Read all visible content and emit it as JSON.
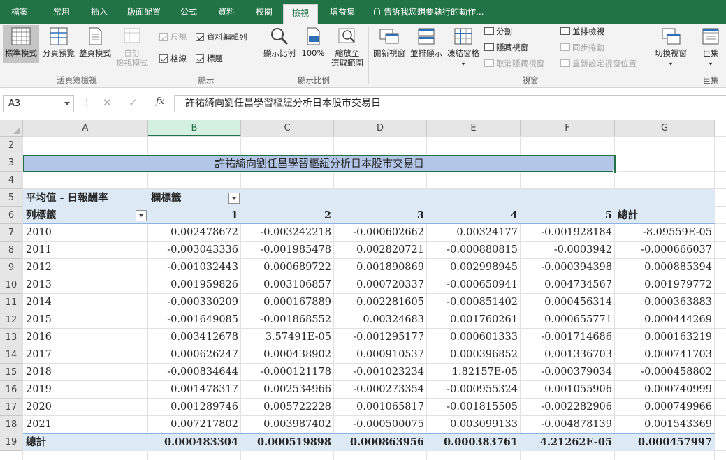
{
  "tabs": [
    {
      "label": "檔案",
      "active": false
    },
    {
      "label": "常用",
      "active": false
    },
    {
      "label": "插入",
      "active": false
    },
    {
      "label": "版面配置",
      "active": false
    },
    {
      "label": "公式",
      "active": false
    },
    {
      "label": "資料",
      "active": false
    },
    {
      "label": "校閱",
      "active": false
    },
    {
      "label": "檢視",
      "active": true
    },
    {
      "label": "增益集",
      "active": false
    }
  ],
  "tell_me": "告訴我您想要執行的動作...",
  "ribbon": {
    "workbook_views": {
      "normal": "標準模式",
      "page_break": "分頁預覽",
      "page_layout": "整頁模式",
      "custom_1": "自訂",
      "custom_2": "檢視模式",
      "label": "活頁簿檢視"
    },
    "show": {
      "ruler": "尺規",
      "formula_bar": "資料編輯列",
      "gridlines": "格線",
      "headings": "標題",
      "label": "顯示"
    },
    "zoom": {
      "zoom": "顯示比例",
      "hundred": "100%",
      "to_sel_1": "縮放至",
      "to_sel_2": "選取範圍",
      "label": "顯示比例"
    },
    "window": {
      "new_window": "開新視窗",
      "arrange_all": "並排顯示",
      "freeze": "凍結窗格",
      "split": "分割",
      "hide": "隱藏視窗",
      "unhide": "取消隱藏視窗",
      "side_by_side": "並排檢視",
      "sync_scroll": "同步捲動",
      "reset_pos": "重新設定視窗位置",
      "switch": "切換視窗",
      "label": "視窗"
    },
    "macros": {
      "macros": "巨集",
      "label": "巨集"
    }
  },
  "formula_bar": {
    "name_box": "A3",
    "cancel": "✕",
    "enter": "✓",
    "fx": "fx",
    "content": "許祐綺向劉任昌學習樞紐分析日本股市交易日"
  },
  "columns": [
    "A",
    "B",
    "C",
    "D",
    "E",
    "F",
    "G"
  ],
  "selected_column": "B",
  "rows": [
    "2",
    "3",
    "4",
    "5",
    "6",
    "7",
    "8",
    "9",
    "10",
    "11",
    "12",
    "13",
    "14",
    "15",
    "16",
    "17",
    "18",
    "19"
  ],
  "sheet": {
    "title": "許祐綺向劉任昌學習樞紐分析日本股市交易日",
    "pivot_value_label": "平均值 - 日報酬率",
    "col_labels": "欄標籤",
    "row_labels": "列標籤",
    "col_headers": [
      "1",
      "2",
      "3",
      "4",
      "5",
      "總計"
    ],
    "data": [
      {
        "year": "2010",
        "v": [
          "0.002478672",
          "-0.003242218",
          "-0.000602662",
          "0.00324177",
          "-0.001928184",
          "-8.09559E-05"
        ]
      },
      {
        "year": "2011",
        "v": [
          "-0.003043336",
          "-0.001985478",
          "0.002820721",
          "-0.000880815",
          "-0.0003942",
          "-0.000666037"
        ]
      },
      {
        "year": "2012",
        "v": [
          "-0.001032443",
          "0.000689722",
          "0.001890869",
          "0.002998945",
          "-0.000394398",
          "0.000885394"
        ]
      },
      {
        "year": "2013",
        "v": [
          "0.001959826",
          "0.003106857",
          "0.000720337",
          "-0.000650941",
          "0.004734567",
          "0.001979772"
        ]
      },
      {
        "year": "2014",
        "v": [
          "-0.000330209",
          "0.000167889",
          "0.002281605",
          "-0.000851402",
          "0.000456314",
          "0.000363883"
        ]
      },
      {
        "year": "2015",
        "v": [
          "-0.001649085",
          "-0.001868552",
          "0.00324683",
          "0.001760261",
          "0.000655771",
          "0.000444269"
        ]
      },
      {
        "year": "2016",
        "v": [
          "0.003412678",
          "3.57491E-05",
          "-0.001295177",
          "0.000601333",
          "-0.001714686",
          "0.000163219"
        ]
      },
      {
        "year": "2017",
        "v": [
          "0.000626247",
          "0.000438902",
          "0.000910537",
          "0.000396852",
          "0.001336703",
          "0.000741703"
        ]
      },
      {
        "year": "2018",
        "v": [
          "-0.000834644",
          "-0.000121178",
          "-0.001023234",
          "1.82157E-05",
          "-0.000379034",
          "-0.000458802"
        ]
      },
      {
        "year": "2019",
        "v": [
          "0.001478317",
          "0.002534966",
          "-0.000273354",
          "-0.000955324",
          "0.001055906",
          "0.000740999"
        ]
      },
      {
        "year": "2020",
        "v": [
          "0.001289746",
          "0.005722228",
          "0.001065817",
          "-0.001815505",
          "-0.002282906",
          "0.000749966"
        ]
      },
      {
        "year": "2021",
        "v": [
          "0.007217802",
          "0.003987402",
          "-0.000500075",
          "0.003099133",
          "-0.004878139",
          "0.001543369"
        ]
      }
    ],
    "total_label": "總計",
    "totals": [
      "0.000483304",
      "0.000519898",
      "0.000863956",
      "0.000383761",
      "4.21262E-05",
      "0.000457997"
    ]
  },
  "colors": {
    "excel_green": "#217346",
    "pivot_band": "#dde9f5",
    "title_fill": "#b4c6e7"
  }
}
